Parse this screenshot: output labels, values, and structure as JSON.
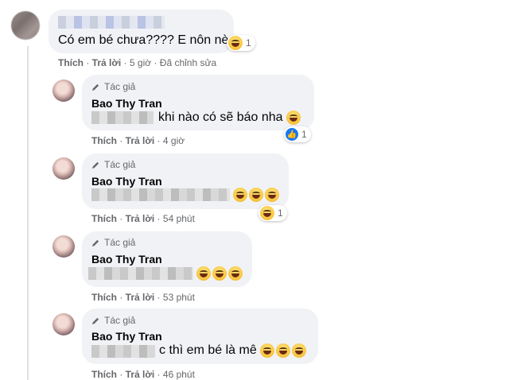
{
  "top_comment": {
    "text": "Có em bé chưa???? E nôn nè",
    "reaction_count": "1",
    "actions": {
      "like": "Thích",
      "reply": "Trả lời",
      "time": "5 giờ",
      "edited": "Đã chỉnh sửa"
    }
  },
  "replies": [
    {
      "badge": "Tác giả",
      "name": "Bao Thy Tran",
      "text": "khi nào có sẽ báo nha",
      "reaction_count": "1",
      "like": "Thích",
      "reply": "Trả lời",
      "time": "4 giờ"
    },
    {
      "badge": "Tác giả",
      "name": "Bao Thy Tran",
      "text": "",
      "reaction_count": "1",
      "like": "Thích",
      "reply": "Trả lời",
      "time": "54 phút"
    },
    {
      "badge": "Tác giả",
      "name": "Bao Thy Tran",
      "text": "",
      "like": "Thích",
      "reply": "Trả lời",
      "time": "53 phút"
    },
    {
      "badge": "Tác giả",
      "name": "Bao Thy Tran",
      "text": "c thì em bé là mê",
      "like": "Thích",
      "reply": "Trả lời",
      "time": "46 phút"
    }
  ],
  "icons": {
    "author_badge": "pencil-icon",
    "laugh": "laughing-emoji-icon",
    "like": "like-reaction-icon"
  },
  "colors": {
    "bubble": "#f0f2f5",
    "meta": "#65676b",
    "like_blue": "#1877f2"
  }
}
